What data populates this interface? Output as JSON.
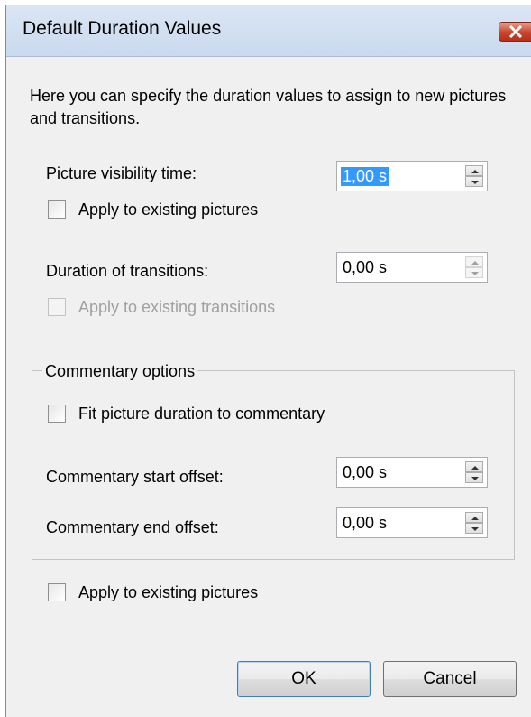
{
  "window": {
    "title": "Default Duration Values"
  },
  "description": "Here you can specify the duration values to assign to new pictures and transitions.",
  "picture_visibility": {
    "label": "Picture visibility time:",
    "value": "1,00 s",
    "apply_label": "Apply to existing pictures",
    "apply_checked": false
  },
  "transitions": {
    "label": "Duration of transitions:",
    "value": "0,00 s",
    "apply_label": "Apply to existing transitions",
    "apply_checked": false,
    "apply_enabled": false
  },
  "commentary": {
    "group_label": "Commentary options",
    "fit_label": "Fit picture duration to commentary",
    "fit_checked": false,
    "start_label": "Commentary start offset:",
    "start_value": "0,00 s",
    "end_label": "Commentary end offset:",
    "end_value": "0,00 s"
  },
  "apply_existing": {
    "label": "Apply to existing pictures",
    "checked": false
  },
  "buttons": {
    "ok": "OK",
    "cancel": "Cancel"
  },
  "colors": {
    "title_bar": "#dbe6f4",
    "close_button": "#c8442a",
    "selection": "#3399ff",
    "dialog_background": "#f0f0f0",
    "disabled_text": "#a0a0a0"
  }
}
